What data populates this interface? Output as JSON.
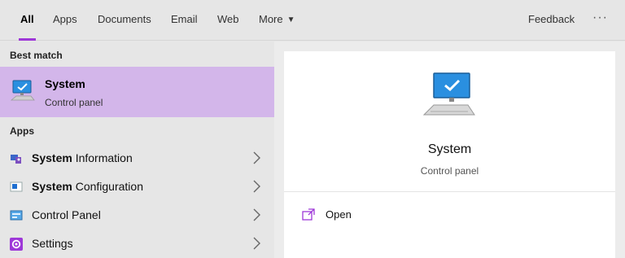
{
  "tabs": [
    {
      "label": "All",
      "active": true
    },
    {
      "label": "Apps"
    },
    {
      "label": "Documents"
    },
    {
      "label": "Email"
    },
    {
      "label": "Web"
    },
    {
      "label": "More"
    }
  ],
  "header": {
    "feedback_label": "Feedback",
    "more_options": "···"
  },
  "left": {
    "best_match_title": "Best match",
    "best_match": {
      "title": "System",
      "subtitle": "Control panel",
      "icon": "monitor-icon"
    },
    "apps_title": "Apps",
    "apps": [
      {
        "bold": "System",
        "rest": " Information",
        "icon": "system-info-icon"
      },
      {
        "bold": "System",
        "rest": " Configuration",
        "icon": "system-config-icon"
      },
      {
        "bold": "",
        "rest": "Control Panel",
        "icon": "control-panel-icon"
      },
      {
        "bold": "",
        "rest": "Settings",
        "icon": "settings-gear-icon"
      }
    ]
  },
  "right": {
    "title": "System",
    "category": "Control panel",
    "actions": [
      {
        "label": "Open",
        "icon": "open-icon"
      }
    ]
  },
  "colors": {
    "accent": "#9e38d8",
    "selected_bg": "#d3b6ea",
    "monitor_blue": "#2a8fe0"
  }
}
